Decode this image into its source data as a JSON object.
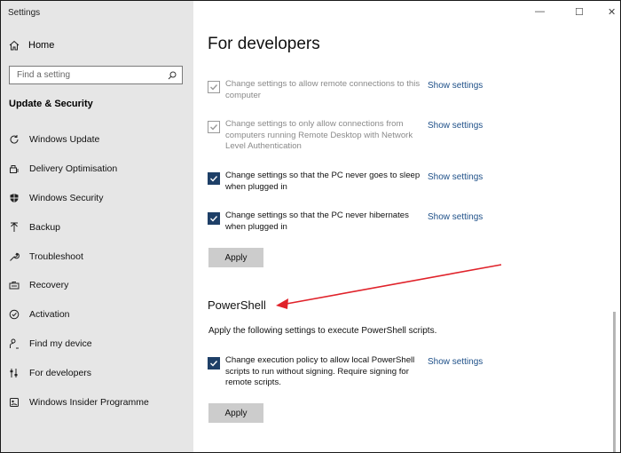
{
  "window": {
    "title": "Settings",
    "controls": [
      "—",
      "☐",
      "✕"
    ]
  },
  "sidebar": {
    "home_label": "Home",
    "search_placeholder": "Find a setting",
    "section_title": "Update & Security",
    "items": [
      {
        "label": "Windows Update",
        "icon": "refresh-icon"
      },
      {
        "label": "Delivery Optimisation",
        "icon": "delivery-icon"
      },
      {
        "label": "Windows Security",
        "icon": "shield-icon"
      },
      {
        "label": "Backup",
        "icon": "backup-arrow-icon"
      },
      {
        "label": "Troubleshoot",
        "icon": "wrench-icon"
      },
      {
        "label": "Recovery",
        "icon": "recovery-icon"
      },
      {
        "label": "Activation",
        "icon": "check-circle-icon"
      },
      {
        "label": "Find my device",
        "icon": "person-pin-icon"
      },
      {
        "label": "For developers",
        "icon": "developer-sliders-icon"
      },
      {
        "label": "Windows Insider Programme",
        "icon": "insider-icon"
      }
    ]
  },
  "main": {
    "title": "For developers",
    "show_settings": "Show settings",
    "apply_label": "Apply",
    "remote_settings": [
      {
        "text": "Change settings to allow remote connections to this computer",
        "checked": true,
        "disabled": true
      },
      {
        "text": "Change settings to only allow connections from computers running Remote Desktop with Network Level Authentication",
        "checked": true,
        "disabled": true
      },
      {
        "text": "Change settings so that the PC never goes to sleep when plugged in",
        "checked": true,
        "disabled": false
      },
      {
        "text": "Change settings so that the PC never hibernates when plugged in",
        "checked": true,
        "disabled": false
      }
    ],
    "powershell": {
      "title": "PowerShell",
      "description": "Apply the following settings to execute PowerShell scripts.",
      "setting": {
        "text": "Change execution policy to allow local PowerShell scripts to run without signing. Require signing for remote scripts.",
        "checked": true
      }
    }
  },
  "colors": {
    "checkbox_checked": "#1e3f67",
    "link": "#1d4f88",
    "arrow": "#e0222a",
    "sidebar_bg": "#e6e6e6"
  }
}
